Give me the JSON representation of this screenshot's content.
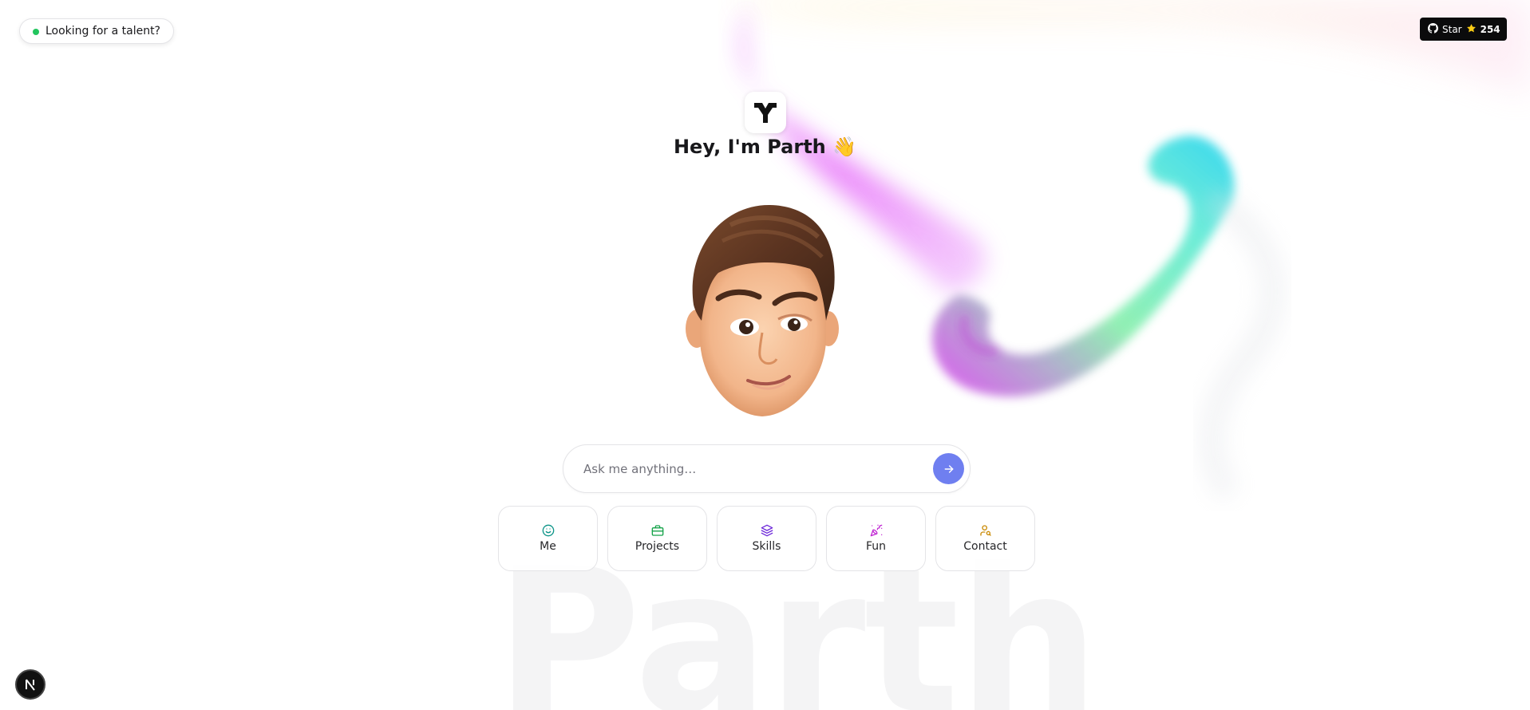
{
  "hero": {
    "greeting": "Hey, I'm Parth",
    "wave_emoji": "👋",
    "background_word": "Parth",
    "logo_icon": "logo-mark-icon",
    "avatar_icon": "memoji-avatar"
  },
  "top_left": {
    "pill_label": "Looking for a talent?",
    "status_color": "#22c55e"
  },
  "github": {
    "label": "Star",
    "count": "254",
    "icon": "github-icon",
    "star_icon": "star-icon"
  },
  "ask": {
    "placeholder": "Ask me anything…",
    "value": "",
    "send_icon": "arrow-right-icon",
    "accent": "#6f7ff0"
  },
  "quick_actions": [
    {
      "label": "Me",
      "icon": "smile-icon",
      "color": "#0d9488"
    },
    {
      "label": "Projects",
      "icon": "briefcase-icon",
      "color": "#16a34a"
    },
    {
      "label": "Skills",
      "icon": "layers-icon",
      "color": "#6d28d9"
    },
    {
      "label": "Fun",
      "icon": "party-popper-icon",
      "color": "#c026d3"
    },
    {
      "label": "Contact",
      "icon": "user-search-icon",
      "color": "#ca8a04"
    }
  ],
  "footer": {
    "framework_badge": "N"
  }
}
